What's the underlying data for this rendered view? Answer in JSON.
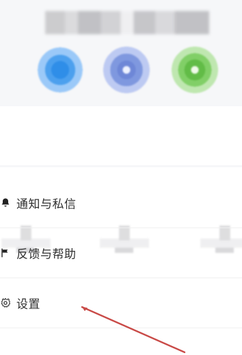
{
  "menu": {
    "items": [
      {
        "label": "通知与私信",
        "icon": "bell-icon"
      },
      {
        "label": "反馈与帮助",
        "icon": "flag-icon"
      },
      {
        "label": "设置",
        "icon": "gear-icon"
      }
    ]
  },
  "colors": {
    "accent_blue": "#2f8ee8",
    "accent_indigo": "#7f98df",
    "accent_green": "#62bc47",
    "annotation_red": "#c94a47"
  }
}
